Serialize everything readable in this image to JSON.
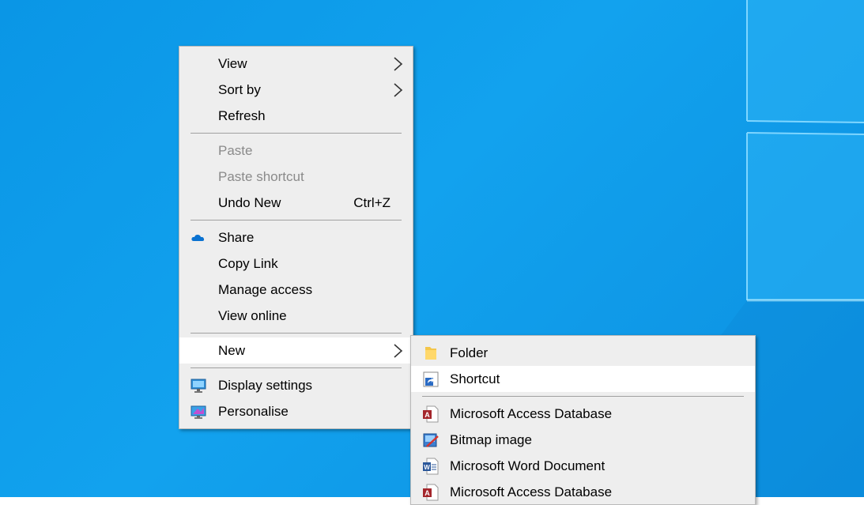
{
  "context_menu": {
    "group1": [
      {
        "label": "View",
        "submenu": true
      },
      {
        "label": "Sort by",
        "submenu": true
      },
      {
        "label": "Refresh"
      }
    ],
    "group2": [
      {
        "label": "Paste",
        "disabled": true
      },
      {
        "label": "Paste shortcut",
        "disabled": true
      },
      {
        "label": "Undo New",
        "shortcut": "Ctrl+Z"
      }
    ],
    "group3": [
      {
        "label": "Share",
        "icon": "onedrive-cloud-icon"
      },
      {
        "label": "Copy Link"
      },
      {
        "label": "Manage access"
      },
      {
        "label": "View online"
      }
    ],
    "group4": [
      {
        "label": "New",
        "submenu": true,
        "highlighted": true
      }
    ],
    "group5": [
      {
        "label": "Display settings",
        "icon": "display-settings-icon"
      },
      {
        "label": "Personalise",
        "icon": "personalise-icon"
      }
    ]
  },
  "new_submenu": {
    "group1": [
      {
        "label": "Folder",
        "icon": "folder-icon"
      },
      {
        "label": "Shortcut",
        "icon": "shortcut-icon",
        "highlighted": true
      }
    ],
    "group2": [
      {
        "label": "Microsoft Access Database",
        "icon": "access-database-icon"
      },
      {
        "label": "Bitmap image",
        "icon": "bitmap-image-icon"
      },
      {
        "label": "Microsoft Word Document",
        "icon": "word-document-icon"
      },
      {
        "label": "Microsoft Access Database",
        "icon": "access-database-icon"
      }
    ]
  },
  "colors": {
    "desktop_background": "#0a96e6",
    "menu_background": "#eeeeee",
    "highlight": "#ffffff",
    "disabled_text": "#8a8a8a"
  }
}
